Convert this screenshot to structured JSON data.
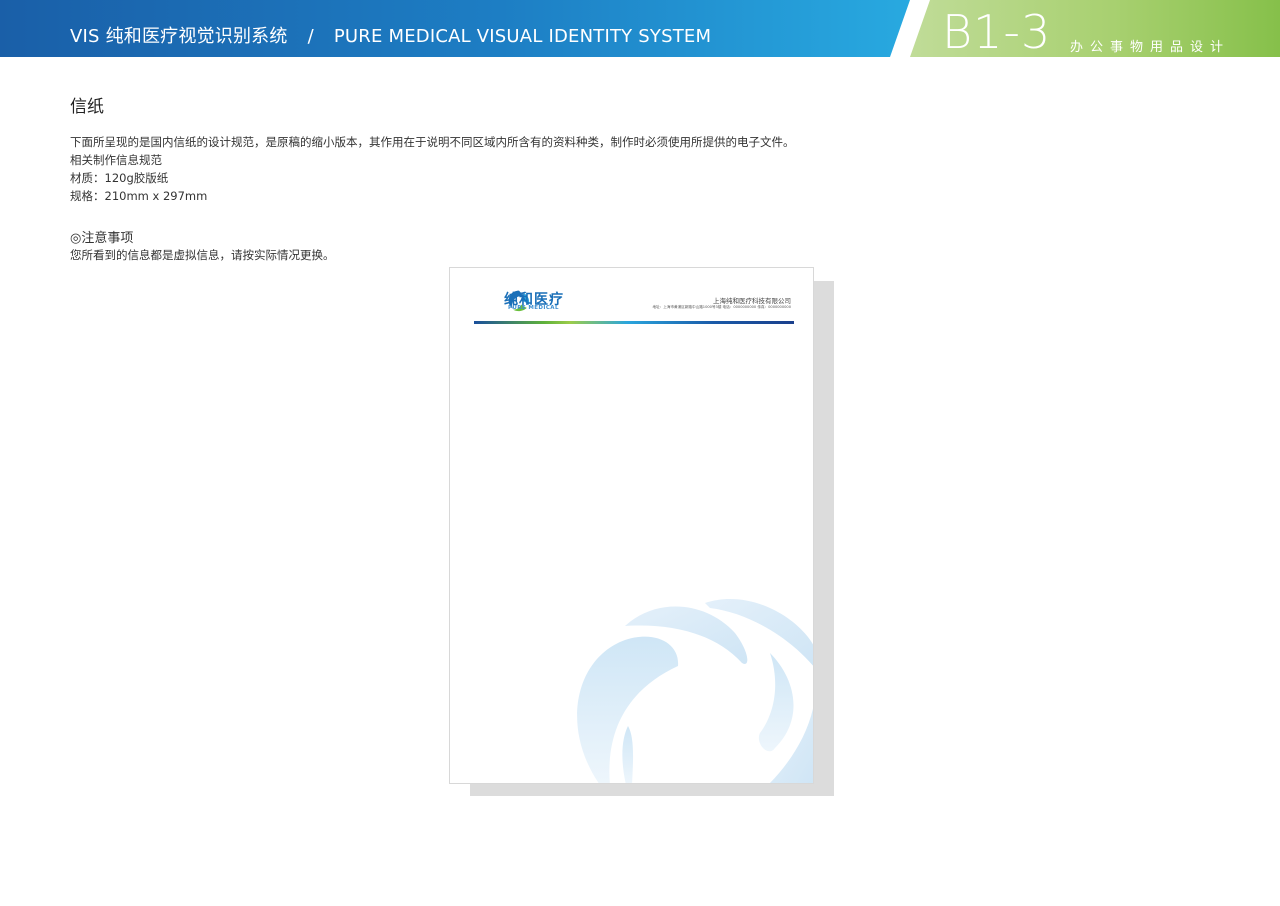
{
  "header": {
    "title_cn": "VIS  纯和医疗视觉识别系统",
    "separator": "/",
    "title_en": "PURE MEDICAL VISUAL IDENTITY SYSTEM",
    "code": "B1-3",
    "section_name": "办公事物用品设计",
    "colors": {
      "blue": "#1d7ec4",
      "green": "#a8d070"
    }
  },
  "page": {
    "title": "信纸",
    "description": [
      "下面所呈现的是国内信纸的设计规范，是原稿的缩小版本，其作用在于说明不同区域内所含有的资料种类，制作时必须使用所提供的电子文件。",
      "相关制作信息规范",
      "材质：120g胶版纸",
      "规格：210mm x 297mm"
    ],
    "notes_title": "◎注意事项",
    "notes_text": "您所看到的信息都是虚拟信息，请按实际情况更换。"
  },
  "letterhead": {
    "brand_cn": "纯和医疗",
    "brand_en": "PURE MEDICAL",
    "company": "上海纯和医疗科技有限公司",
    "address": "地址：上海市黄浦区新路中山路1000号3楼    电话：0000000000    传真：0000000000",
    "logo_icon": "swirl-logo-icon",
    "watermark_icon": "swirl-watermark-icon"
  }
}
